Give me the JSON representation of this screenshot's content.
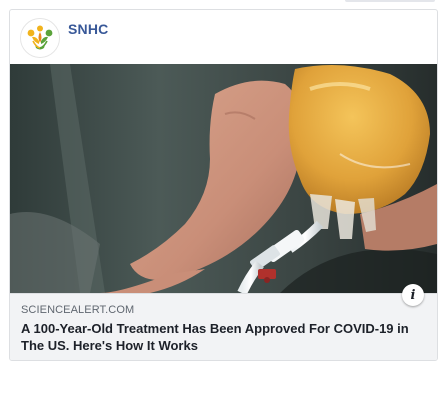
{
  "post": {
    "page_name": "SNHC",
    "avatar_icon": "snhc-logo-icon",
    "image_description_icon": "plasma-bag-image"
  },
  "link_preview": {
    "domain": "SCIENCEALERT.COM",
    "headline": "A 100-Year-Old Treatment Has Been Approved For COVID-19 in The US. Here's How It Works",
    "info_icon": "info-icon",
    "info_glyph": "i"
  },
  "colors": {
    "page_name": "#385898",
    "headline": "#1d2129",
    "domain": "#606770",
    "preview_bg": "#f2f3f5",
    "plasma": "#e0a23a"
  }
}
